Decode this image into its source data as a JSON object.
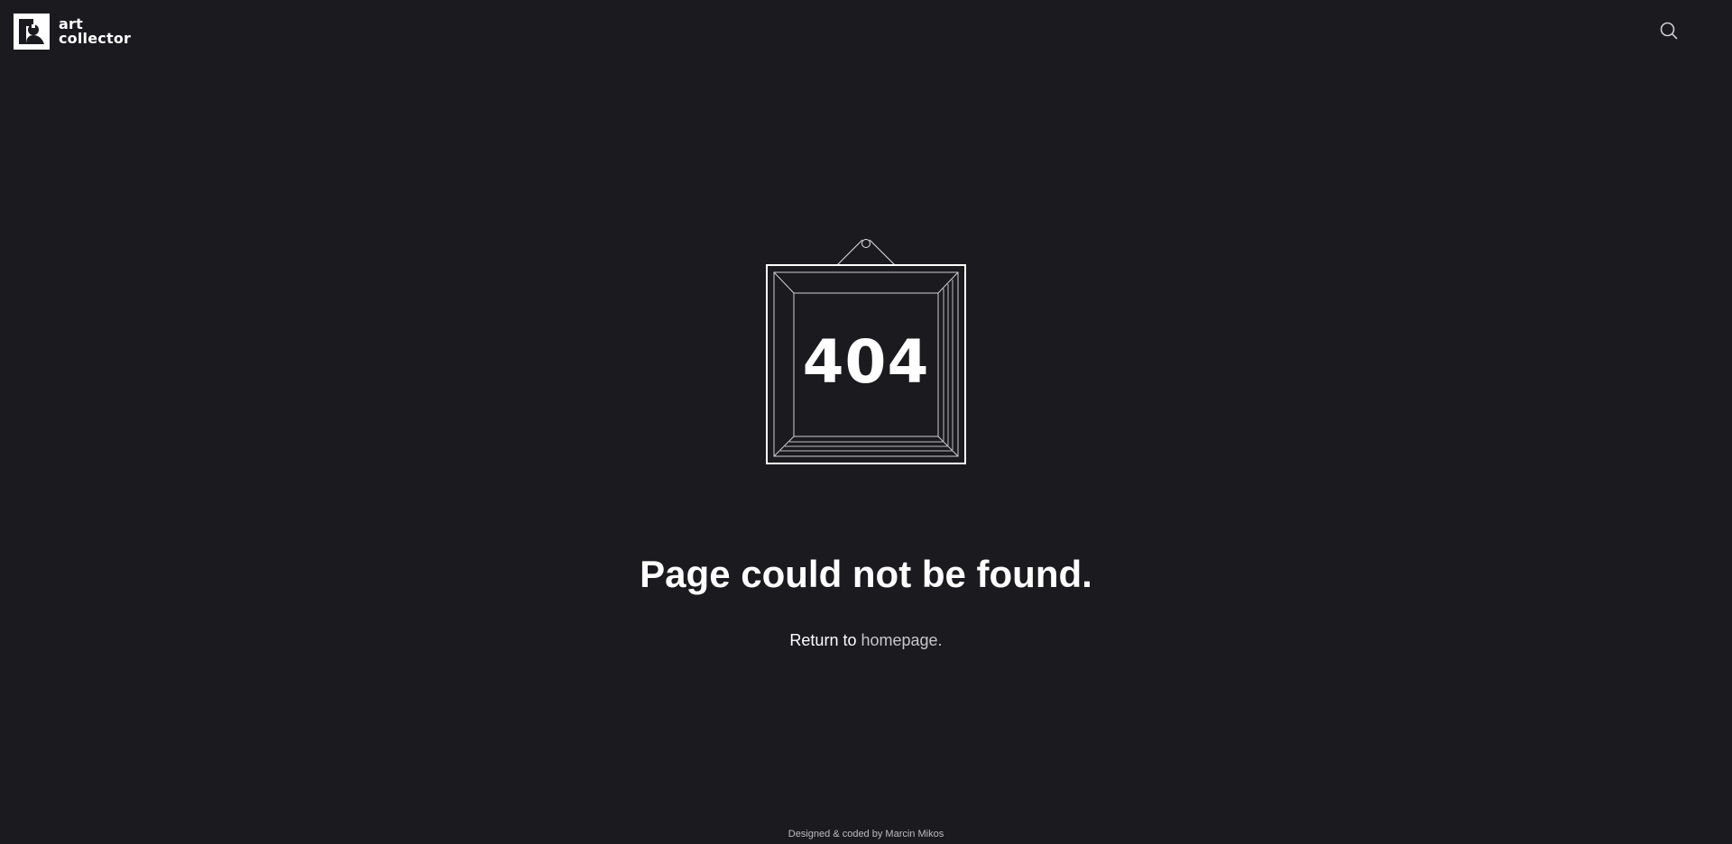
{
  "header": {
    "brand_line1": "art",
    "brand_line2": "collector",
    "logo_icon": "art-collector-logo-icon",
    "search_icon": "search-icon"
  },
  "error": {
    "code": "404",
    "illustration_icon": "picture-frame-icon",
    "headline": "Page could not be found.",
    "return_prefix": "Return to",
    "return_link": "homepage."
  },
  "footer": {
    "prefix": "Designed & coded by",
    "author": "Marcin Mikos"
  },
  "colors": {
    "background": "#1b1a1f",
    "text": "#ffffff",
    "link_muted": "#c8c8cc",
    "footer_text": "#bdbdc2"
  }
}
